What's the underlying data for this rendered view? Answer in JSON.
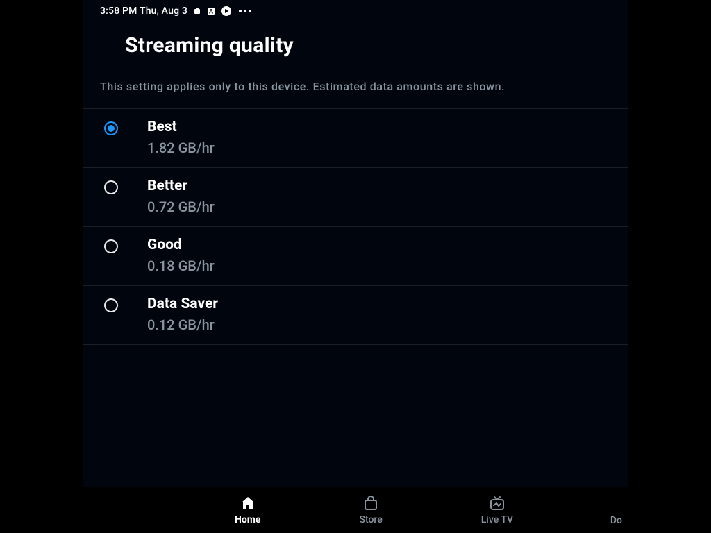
{
  "status_bar": {
    "time": "3:58 PM Thu, Aug 3"
  },
  "page": {
    "title": "Streaming quality",
    "description": "This setting applies only to this device. Estimated data amounts are shown."
  },
  "options": [
    {
      "label": "Best",
      "sub": "1.82 GB/hr",
      "selected": true
    },
    {
      "label": "Better",
      "sub": "0.72 GB/hr",
      "selected": false
    },
    {
      "label": "Good",
      "sub": "0.18 GB/hr",
      "selected": false
    },
    {
      "label": "Data Saver",
      "sub": "0.12 GB/hr",
      "selected": false
    }
  ],
  "nav": {
    "items": [
      {
        "label": "Home",
        "active": true
      },
      {
        "label": "Store",
        "active": false
      },
      {
        "label": "Live TV",
        "active": false
      }
    ],
    "partial": "Do"
  }
}
